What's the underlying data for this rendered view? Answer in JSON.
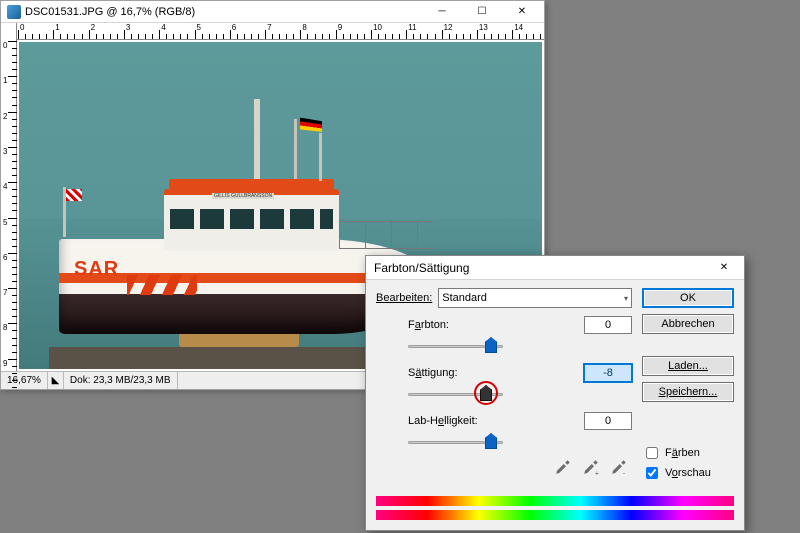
{
  "doc": {
    "title": "DSC01531.JPG @ 16,7% (RGB/8)",
    "ruler_labels": [
      "0",
      "1",
      "2",
      "3",
      "4",
      "5",
      "6",
      "7",
      "8",
      "9",
      "10",
      "11",
      "12",
      "13",
      "14"
    ],
    "ruler_v_labels": [
      "0",
      "1",
      "2",
      "3",
      "4",
      "5",
      "6",
      "7",
      "8",
      "9"
    ],
    "boat_sar": "SAR",
    "boat_plate": "GILLIS GULLBRANSSON"
  },
  "status": {
    "zoom": "16,67%",
    "doksize": "Dok: 23,3 MB/23,3 MB"
  },
  "dialog": {
    "title": "Farbton/Sättigung",
    "edit_label": "Bearbeiten:",
    "edit_value": "Standard",
    "hue_label_pre": "F",
    "hue_label_ul": "a",
    "hue_label_post": "rbton:",
    "hue_value": "0",
    "sat_label_pre": "S",
    "sat_label_ul": "ä",
    "sat_label_post": "ttigung:",
    "sat_value": "-8",
    "light_label_pre": "Lab-H",
    "light_label_ul": "e",
    "light_label_post": "lligkeit:",
    "light_value": "0",
    "ok": "OK",
    "cancel": "Abbrechen",
    "load": "Laden...",
    "save": "Speichern...",
    "colorize_pre": "F",
    "colorize_ul": "ä",
    "colorize_post": "rben",
    "preview_pre": "V",
    "preview_ul": "o",
    "preview_post": "rschau"
  },
  "slider_pos": {
    "hue": 50,
    "sat": 47,
    "light": 50
  }
}
